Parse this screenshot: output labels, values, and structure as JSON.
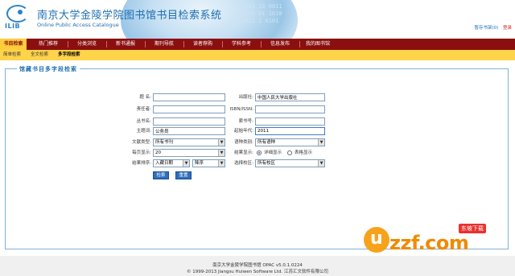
{
  "header": {
    "logo_text": "ILIB",
    "title": "南京大学金陵学院图书馆书目检索系统",
    "subtitle": "Online Public Access Catalogue",
    "binary_text": "0101 10 0011\n1100 01 1010\n0011 1 0101",
    "links": [
      "暂存书架(0)",
      "登录"
    ]
  },
  "navbar": {
    "tabs": [
      "书目检索",
      "热门推荐",
      "分类浏览",
      "新书通报",
      "期刊导航",
      "读者荐购",
      "学科参考",
      "信息发布",
      "我的图书馆"
    ]
  },
  "subnav": {
    "items": [
      "简单检索",
      "全文检索",
      "多字段检索"
    ]
  },
  "panel": {
    "title": "馆藏书目多字段检索"
  },
  "form": {
    "title_label": "题  名:",
    "title_value": "",
    "publisher_label": "出版社:",
    "publisher_value": "中国人民大学出版社",
    "author_label": "责任者:",
    "author_value": "",
    "isbn_label": "ISBN/ISSN:",
    "isbn_value": "",
    "series_label": "丛书名:",
    "series_value": "",
    "callno_label": "索书号:",
    "callno_value": "",
    "subject_label": "主题词:",
    "subject_value": "公务员",
    "year_label": "起始年代:",
    "year_value": "2011",
    "doctype_label": "文献类型:",
    "doctype_value": "所有书刊",
    "lang_label": "语种类别:",
    "lang_value": "所有语种",
    "perpage_label": "每页显示:",
    "perpage_value": "20",
    "display_label": "结果显示:",
    "display_opt1": "详细显示",
    "display_opt2": "表格显示",
    "sort_label": "结果排序:",
    "sort_value": "入藏日期",
    "order_value": "降序",
    "campus_label": "选择校区:",
    "campus_value": "所有校区",
    "search_btn": "检索",
    "reset_btn": "重置"
  },
  "footer": {
    "line1": "南京大学金陵学院图书馆     OPAC v5.0.1.0224",
    "line2": "© 1999-2013 Jiangsu Huiwen Software Ltd. 江苏汇文软件有限公司"
  },
  "watermark": {
    "u": "u",
    "rest": "zzf.com",
    "badge": "东坡下载"
  }
}
